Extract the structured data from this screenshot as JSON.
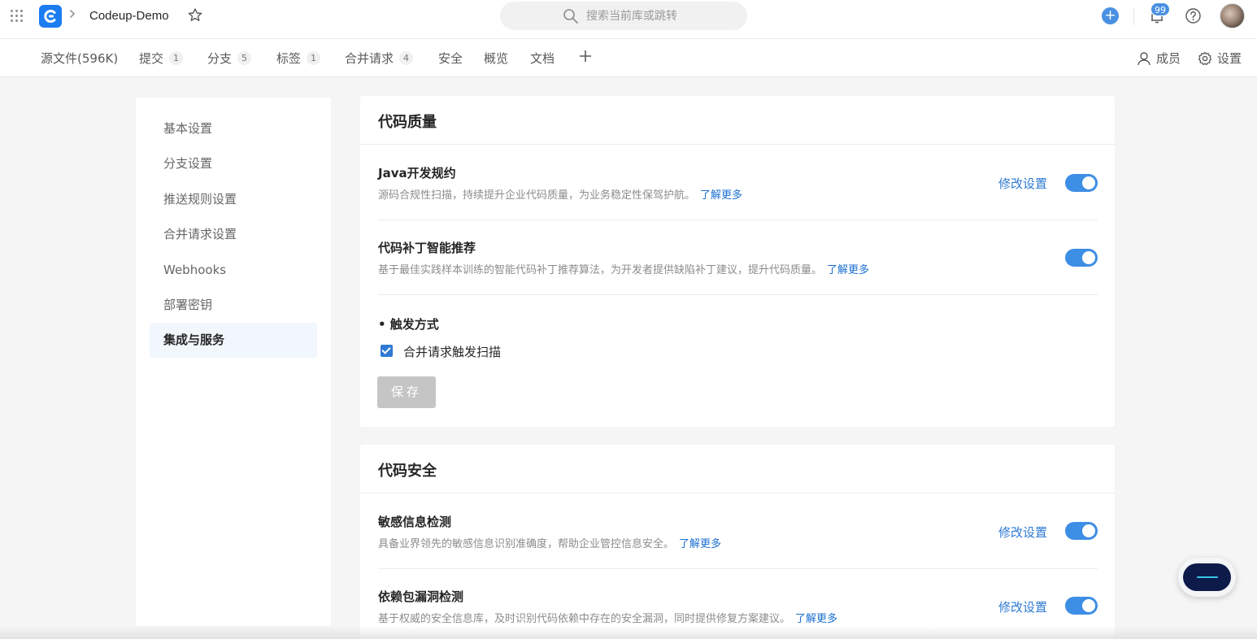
{
  "header": {
    "repo_name": "Codeup-Demo",
    "search_placeholder": "搜索当前库或跳转",
    "notification_count": "99",
    "brand_color": "#1b7cf0",
    "accent_color": "#4a90e2"
  },
  "tabs": [
    {
      "label": "源文件(596K)",
      "count": ""
    },
    {
      "label": "提交",
      "count": "1"
    },
    {
      "label": "分支",
      "count": "5"
    },
    {
      "label": "标签",
      "count": "1"
    },
    {
      "label": "合并请求",
      "count": "4"
    },
    {
      "label": "安全",
      "count": ""
    },
    {
      "label": "概览",
      "count": ""
    },
    {
      "label": "文档",
      "count": ""
    }
  ],
  "tab_actions": {
    "members": "成员",
    "settings": "设置"
  },
  "sidebar": {
    "items": [
      {
        "label": "基本设置"
      },
      {
        "label": "分支设置"
      },
      {
        "label": "推送规则设置"
      },
      {
        "label": "合并请求设置"
      },
      {
        "label": "Webhooks"
      },
      {
        "label": "部署密钥"
      },
      {
        "label": "集成与服务",
        "active": true
      }
    ]
  },
  "code_quality": {
    "title": "代码质量",
    "items": [
      {
        "title": "Java开发规约",
        "desc": "源码合规性扫描，持续提升企业代码质量，为业务稳定性保驾护航。",
        "learn_more": "了解更多",
        "modify": "修改设置",
        "enabled": true
      },
      {
        "title": "代码补丁智能推荐",
        "desc": "基于最佳实践样本训练的智能代码补丁推荐算法，为开发者提供缺陷补丁建议，提升代码质量。",
        "learn_more": "了解更多",
        "enabled": true
      }
    ],
    "trigger_title": "• 触发方式",
    "trigger_option": "合并请求触发扫描",
    "trigger_checked": true,
    "save_label": "保存"
  },
  "code_security": {
    "title": "代码安全",
    "items": [
      {
        "title": "敏感信息检测",
        "desc": "具备业界领先的敏感信息识别准确度，帮助企业管控信息安全。",
        "learn_more": "了解更多",
        "modify": "修改设置",
        "enabled": true
      },
      {
        "title": "依赖包漏洞检测",
        "desc": "基于权威的安全信息库，及时识别代码依赖中存在的安全漏洞，同时提供修复方案建议。",
        "learn_more": "了解更多",
        "modify": "修改设置",
        "enabled": true
      }
    ]
  }
}
